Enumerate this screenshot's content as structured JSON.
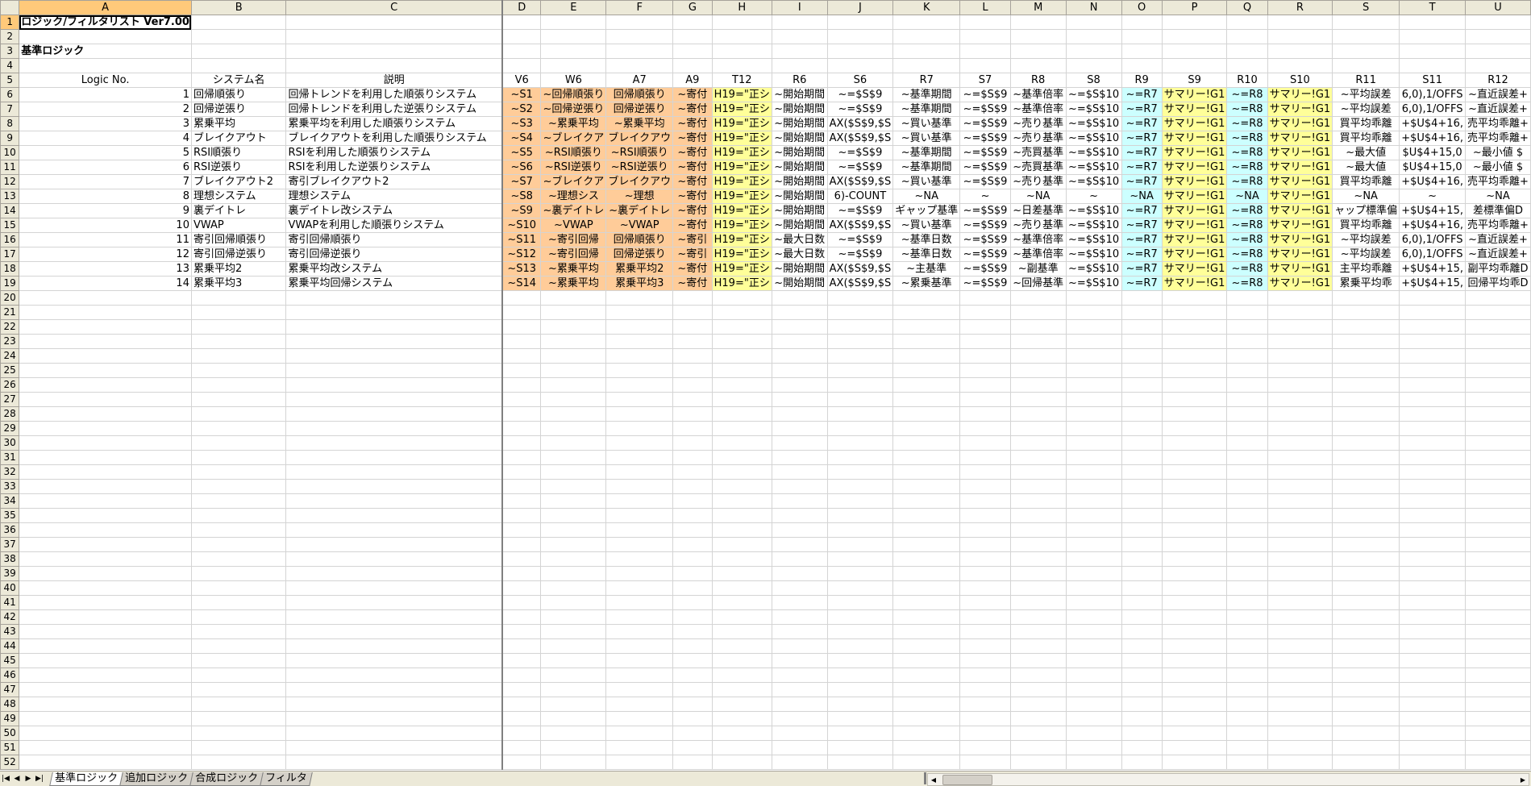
{
  "columns": [
    "A",
    "B",
    "C",
    "D",
    "E",
    "F",
    "G",
    "H",
    "I",
    "J",
    "K",
    "L",
    "M",
    "N",
    "O",
    "P",
    "Q",
    "R",
    "S",
    "T",
    "U"
  ],
  "title": "ロジック/フィルタリスト Ver7.00",
  "section": "基準ロジック",
  "headers": [
    "Logic No.",
    "システム名",
    "説明",
    "V6",
    "W6",
    "A7",
    "A9",
    "T12",
    "R6",
    "S6",
    "R7",
    "S7",
    "R8",
    "S8",
    "R9",
    "S9",
    "R10",
    "S10",
    "R11",
    "S11",
    "R12"
  ],
  "rows": [
    [
      "1",
      "回帰順張り",
      "回帰トレンドを利用した順張りシステム",
      "~S1",
      "~回帰順張り",
      "回帰順張り",
      "~寄付",
      "H19=\"正シ",
      "~開始期間",
      "~=$S$9",
      "~基準期間",
      "~=$S$9",
      "~基準倍率",
      "~=$S$10",
      "~=R7",
      "サマリー!G1",
      "~=R8",
      "サマリー!G1",
      "~平均誤差",
      "6,0),1/OFFS",
      "~直近誤差+"
    ],
    [
      "2",
      "回帰逆張り",
      "回帰トレンドを利用した逆張りシステム",
      "~S2",
      "~回帰逆張り",
      "回帰逆張り",
      "~寄付",
      "H19=\"正シ",
      "~開始期間",
      "~=$S$9",
      "~基準期間",
      "~=$S$9",
      "~基準倍率",
      "~=$S$10",
      "~=R7",
      "サマリー!G1",
      "~=R8",
      "サマリー!G1",
      "~平均誤差",
      "6,0),1/OFFS",
      "~直近誤差+"
    ],
    [
      "3",
      "累乗平均",
      "累乗平均を利用した順張りシステム",
      "~S3",
      "~累乗平均",
      "~累乗平均",
      "~寄付",
      "H19=\"正シ",
      "~開始期間",
      "AX($S$9,$S",
      "~買い基準",
      "~=$S$9",
      "~売り基準",
      "~=$S$10",
      "~=R7",
      "サマリー!G1",
      "~=R8",
      "サマリー!G1",
      "買平均乖離",
      "+$U$4+16,",
      "売平均乖離+"
    ],
    [
      "4",
      "ブレイクアウト",
      "ブレイクアウトを利用した順張りシステム",
      "~S4",
      "~ブレイクア",
      "ブレイクアウ",
      "~寄付",
      "H19=\"正シ",
      "~開始期間",
      "AX($S$9,$S",
      "~買い基準",
      "~=$S$9",
      "~売り基準",
      "~=$S$10",
      "~=R7",
      "サマリー!G1",
      "~=R8",
      "サマリー!G1",
      "買平均乖離",
      "+$U$4+16,",
      "売平均乖離+"
    ],
    [
      "5",
      "RSI順張り",
      "RSIを利用した順張りシステム",
      "~S5",
      "~RSI順張り",
      "~RSI順張り",
      "~寄付",
      "H19=\"正シ",
      "~開始期間",
      "~=$S$9",
      "~基準期間",
      "~=$S$9",
      "~売買基準",
      "~=$S$10",
      "~=R7",
      "サマリー!G1",
      "~=R8",
      "サマリー!G1",
      "~最大値",
      "$U$4+15,0",
      "~最小値 $"
    ],
    [
      "6",
      "RSI逆張り",
      "RSIを利用した逆張りシステム",
      "~S6",
      "~RSI逆張り",
      "~RSI逆張り",
      "~寄付",
      "H19=\"正シ",
      "~開始期間",
      "~=$S$9",
      "~基準期間",
      "~=$S$9",
      "~売買基準",
      "~=$S$10",
      "~=R7",
      "サマリー!G1",
      "~=R8",
      "サマリー!G1",
      "~最大値",
      "$U$4+15,0",
      "~最小値 $"
    ],
    [
      "7",
      "ブレイクアウト2",
      "寄引ブレイクアウト2",
      "~S7",
      "~ブレイクア",
      "ブレイクアウ",
      "~寄付",
      "H19=\"正シ",
      "~開始期間",
      "AX($S$9,$S",
      "~買い基準",
      "~=$S$9",
      "~売り基準",
      "~=$S$10",
      "~=R7",
      "サマリー!G1",
      "~=R8",
      "サマリー!G1",
      "買平均乖離",
      "+$U$4+16,",
      "売平均乖離+"
    ],
    [
      "8",
      "理想システム",
      "理想システム",
      "~S8",
      "~理想シス",
      "~理想",
      "~寄付",
      "H19=\"正シ",
      "~開始期間",
      "6)-COUNT",
      "~NA",
      "~",
      "~NA",
      "~",
      "~NA",
      "サマリー!G1",
      "~NA",
      "サマリー!G1",
      "~NA",
      "~",
      "~NA"
    ],
    [
      "9",
      "裏デイトレ",
      "裏デイトレ改システム",
      "~S9",
      "~裏デイトレ",
      "~裏デイトレ",
      "~寄付",
      "H19=\"正シ",
      "~開始期間",
      "~=$S$9",
      "ギャップ基準",
      "~=$S$9",
      "~日差基準",
      "~=$S$10",
      "~=R7",
      "サマリー!G1",
      "~=R8",
      "サマリー!G1",
      "ャップ標準偏",
      "+$U$4+15,",
      "差標準偏D"
    ],
    [
      "10",
      "VWAP",
      "VWAPを利用した順張りシステム",
      "~S10",
      "~VWAP",
      "~VWAP",
      "~寄付",
      "H19=\"正シ",
      "~開始期間",
      "AX($S$9,$S",
      "~買い基準",
      "~=$S$9",
      "~売り基準",
      "~=$S$10",
      "~=R7",
      "サマリー!G1",
      "~=R8",
      "サマリー!G1",
      "買平均乖離",
      "+$U$4+16,",
      "売平均乖離+"
    ],
    [
      "11",
      "寄引回帰順張り",
      "寄引回帰順張り",
      "~S11",
      "~寄引回帰",
      "回帰順張り",
      "~寄引",
      "H19=\"正シ",
      "~最大日数",
      "~=$S$9",
      "~基準日数",
      "~=$S$9",
      "~基準倍率",
      "~=$S$10",
      "~=R7",
      "サマリー!G1",
      "~=R8",
      "サマリー!G1",
      "~平均誤差",
      "6,0),1/OFFS",
      "~直近誤差+"
    ],
    [
      "12",
      "寄引回帰逆張り",
      "寄引回帰逆張り",
      "~S12",
      "~寄引回帰",
      "回帰逆張り",
      "~寄引",
      "H19=\"正シ",
      "~最大日数",
      "~=$S$9",
      "~基準日数",
      "~=$S$9",
      "~基準倍率",
      "~=$S$10",
      "~=R7",
      "サマリー!G1",
      "~=R8",
      "サマリー!G1",
      "~平均誤差",
      "6,0),1/OFFS",
      "~直近誤差+"
    ],
    [
      "13",
      "累乗平均2",
      "累乗平均改システム",
      "~S13",
      "~累乗平均",
      "累乗平均2",
      "~寄付",
      "H19=\"正シ",
      "~開始期間",
      "AX($S$9,$S",
      "~主基準",
      "~=$S$9",
      "~副基準",
      "~=$S$10",
      "~=R7",
      "サマリー!G1",
      "~=R8",
      "サマリー!G1",
      "主平均乖離",
      "+$U$4+15,",
      "副平均乖離D"
    ],
    [
      "14",
      "累乗平均3",
      "累乗平均回帰システム",
      "~S14",
      "~累乗平均",
      "累乗平均3",
      "~寄付",
      "H19=\"正シ",
      "~開始期間",
      "AX($S$9,$S",
      "~累乗基準",
      "~=$S$9",
      "~回帰基準",
      "~=$S$10",
      "~=R7",
      "サマリー!G1",
      "~=R8",
      "サマリー!G1",
      "累乗平均乖",
      "+$U$4+15,",
      "回帰平均乖D"
    ]
  ],
  "sheet_tabs": [
    "基準ロジック",
    "追加ロジック",
    "合成ロジック",
    "フィルタ"
  ],
  "active_tab": "基準ロジック",
  "fill_colors": {
    "orange": "#ffcc99",
    "yellow": "#ffff99",
    "cyan": "#ccffff",
    "header_bg": "#ece9d8",
    "selected_header": "#ffc97a"
  }
}
